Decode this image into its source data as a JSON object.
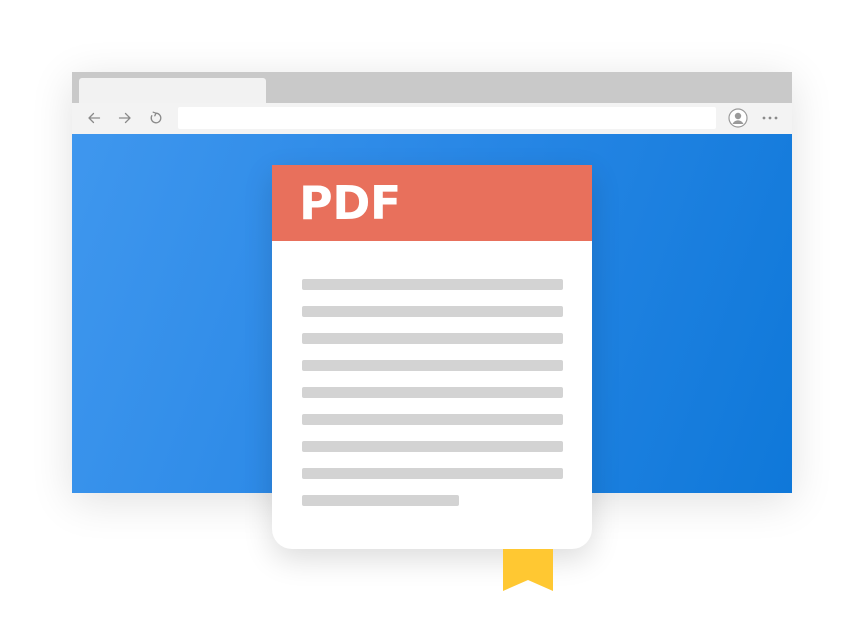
{
  "browser": {
    "tabs": [
      {
        "label": ""
      }
    ],
    "toolbar": {
      "back_icon": "arrow-left-icon",
      "forward_icon": "arrow-right-icon",
      "refresh_icon": "refresh-icon",
      "address_value": "",
      "profile_icon": "user-icon",
      "more_icon": "ellipsis-icon"
    }
  },
  "document": {
    "title": "PDF",
    "line_count": 9,
    "bookmark_icon": "bookmark-icon"
  },
  "colors": {
    "tab_strip": "#c9c9c9",
    "toolbar": "#f3f3f3",
    "content_gradient_start": "#3f97ee",
    "content_gradient_end": "#0f78d9",
    "pdf_header": "#e8705c",
    "text_line": "#d3d3d3",
    "bookmark": "#ffc832"
  }
}
